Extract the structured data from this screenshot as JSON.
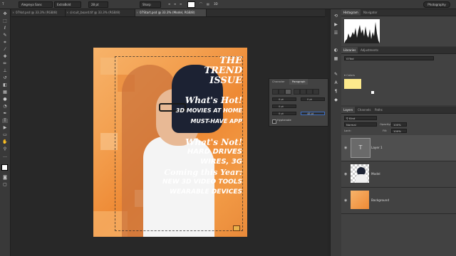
{
  "options_bar": {
    "font_family": "Alegreya Sans",
    "font_style": "ExtraBold",
    "font_size": "28 pt",
    "anti_alias": "Sharp",
    "workspace": "Photography"
  },
  "tabs": [
    {
      "label": "07Ikd.psd @ 33.3% (RGB/8)"
    },
    {
      "label": "circuit_board.tif @ 33.3% (RGB/8)"
    },
    {
      "label": "07Start.psd @ 33.3% (Model, RGB/8)"
    }
  ],
  "poster": {
    "title_line1": "THE",
    "title_line2": "TREND",
    "title_line3": "ISSUE",
    "hot_heading": "What's Hot!",
    "hot_item1": "3D MOVIES AT HOME",
    "hot_item2": "MUST-HAVE APP",
    "not_heading": "What's Not!",
    "not_item1": "HARD DRIVES",
    "not_item2": "WIRES, 3G",
    "coming_heading": "Coming this Year:",
    "coming_item1": "NEW 3D VIDEO TOOLS",
    "coming_item2": "WEARABLE DEVICES"
  },
  "paragraph_panel": {
    "tab_character": "Character",
    "tab_paragraph": "Paragraph",
    "indent_left": "0 pt",
    "indent_right": "0 pt",
    "indent_first": "0 pt",
    "space_before": "0 pt",
    "space_after": "48 pt",
    "hyphenate_label": "Hyphenate"
  },
  "histogram_panel": {
    "tab_histogram": "Histogram",
    "tab_navigator": "Navigator"
  },
  "libraries_panel": {
    "tab_libraries": "Libraries",
    "tab_adjustments": "Adjustments",
    "library_name": "07Ikd",
    "colors_header": "Colors",
    "swatches": [
      "#fce98c",
      "#ffffff"
    ]
  },
  "layers_panel": {
    "tab_layers": "Layers",
    "tab_channels": "Channels",
    "tab_paths": "Paths",
    "blend_mode": "Normal",
    "opacity_label": "Opacity:",
    "opacity_value": "100%",
    "fill_label": "Fill:",
    "fill_value": "100%",
    "lock_label": "Lock:",
    "layers": [
      {
        "name": "Layer 1",
        "selected": true
      },
      {
        "name": "Model",
        "selected": false
      },
      {
        "name": "Background",
        "selected": false
      }
    ]
  }
}
